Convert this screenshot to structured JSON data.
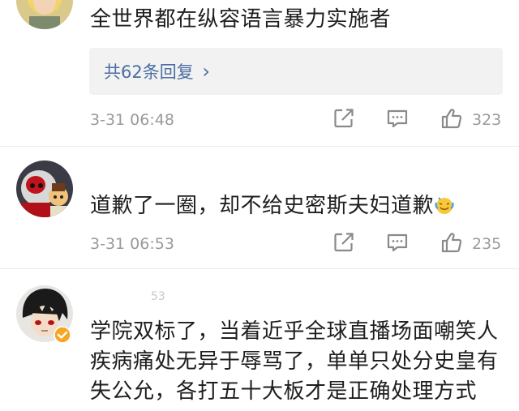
{
  "comments": [
    {
      "text": "全世界都在纵容语言暴力实施者",
      "replies_label": "共62条回复",
      "replies_chevron": "›",
      "time": "3-31 06:48",
      "likes": "323",
      "avatar_icon": "avatar-blonde-person-icon"
    },
    {
      "text": "道歉了一圈，却不给史密斯夫妇道歉",
      "time": "3-31 06:53",
      "likes": "235",
      "avatar_icon": "avatar-cartoon-character-icon"
    },
    {
      "partial_text": "53",
      "text_lines": [
        "学院双标了，当着近乎全球直播场面嘲笑人",
        "疾病痛处无异于辱骂了，单单只处分史皇有",
        "失公允，各打五十大板才是正确处理方式"
      ],
      "avatar_icon": "avatar-anime-character-icon",
      "verified_icon": "verified-badge-icon"
    }
  ],
  "colors": {
    "link_blue": "#4a6ea4",
    "meta_gray": "#9a9a9a",
    "reply_bg": "#f2f2f2",
    "verified_gold": "#f5a623"
  },
  "icons": {
    "share": "share-icon",
    "comment": "comment-icon",
    "like": "thumbs-up-icon",
    "emoji": "sweat-smile-emoji-icon"
  }
}
